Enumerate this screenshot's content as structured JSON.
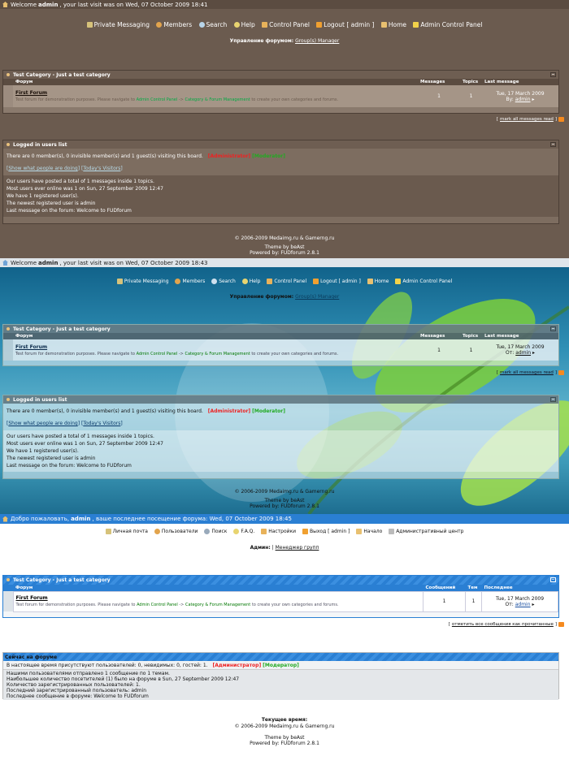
{
  "t1": {
    "welcome_pre": "Welcome",
    "user": "admin",
    "welcome_post": ", your last visit was on Wed, 07 October 2009 18:41",
    "nav": [
      "Private Messaging",
      "Members",
      "Search",
      "Help",
      "Control Panel",
      "Logout [ admin ]",
      "Home",
      "Admin Control Panel"
    ],
    "admin_label": "Управление форумом:",
    "admin_link": "Group(s) Manager",
    "category": "Test Category - Just a test category",
    "col_forum": "Форум",
    "col_messages": "Messages",
    "col_topics": "Topics",
    "col_last": "Last message",
    "forum_name": "First Forum",
    "forum_desc_pre": "Test forum for demonstration purposes. Please navigate to ",
    "forum_link1": "Admin Control Panel",
    "forum_arrow": " -> ",
    "forum_link2": "Category & Forum Management",
    "forum_desc_post": " to create your own categories and forums.",
    "messages": "1",
    "topics": "1",
    "last_date": "Tue, 17 March 2009",
    "by": "By:",
    "by_user": "admin",
    "mark_read": "mark all messages read",
    "logged_title": "Logged in users list",
    "online_line": "There are 0 member(s), 0 invisible member(s) and 1 guest(s) visiting this board.",
    "administrator": "[Administrator]",
    "moderator": "[Moderator]",
    "show_doing": "Show what people are doing",
    "todays": "Today's Visitors",
    "stats": [
      "Our users have posted a total of 1 messages inside 1 topics.",
      "Most users ever online was 1 on Sun, 27 September 2009 12:47",
      "We have 1 registered user(s).",
      "The newest registered user is admin",
      "Last message on the forum: Welcome to FUDforum"
    ],
    "copyright": "© 2006-2009 Medaimg.ru & Gamerng.ru",
    "theme_by": "Theme by beAst",
    "powered": "Powered by: FUDforum 2.8.1"
  },
  "t2": {
    "welcome_post": ", your last visit was on Wed, 07 October 2009 18:43",
    "nav": [
      "Private Messaging",
      "Members",
      "Search",
      "Help",
      "Control Panel",
      "Logout [ admin ]",
      "Home",
      "Admin Control Panel"
    ],
    "admin_label": "Управление форумом:",
    "admin_link": "Group(s) Manager",
    "by": "От:",
    "copyright": "© 2006-2009 Medaimg.ru & Gamerng.ru",
    "theme_by": "Theme by beAst",
    "powered": "Powered by: FUDforum 2.8.1"
  },
  "t3": {
    "welcome": "Добро пожаловать,",
    "user": "admin",
    "welcome_post": ", ваше последнее посещение форума: Wed, 07 October 2009 18:45",
    "nav": [
      "Личная почта",
      "Пользователи",
      "Поиск",
      "F.A.Q.",
      "Настройки",
      "Выход [ admin ]",
      "Начало",
      "Административный центр"
    ],
    "admin_label": "Админ:",
    "admin_link": "Менеджер групп",
    "category": "Test Category - Just a test category",
    "col_forum": "Форум",
    "col_messages": "Сообщений",
    "col_topics": "Тем",
    "col_last": "Последнее",
    "forum_name": "First Forum",
    "messages": "1",
    "topics": "1",
    "last_date": "Tue, 17 March 2009",
    "by": "От:",
    "by_user": "admin",
    "mark_read": "отметить все сообщения как прочитанные",
    "online_title": "Сейчас на форуме",
    "online_line": "В настоящее время присутствуют пользователей: 0, невидимых: 0, гостей: 1.",
    "administrator": "[Администратор]",
    "moderator": "[Модератор]",
    "stats": [
      "Нашими пользователями отправлено 1 сообщение по 1 темам.",
      "Наибольшее количество посетителей (1) было на форуме в Sun, 27 September 2009 12:47",
      "Количество зарегистрированных пользователей: 1.",
      "Последний зарегистрированный пользователь: admin",
      "Последнее сообщение в форуме: Welcome to FUDforum"
    ],
    "current_time": "Текущее время:",
    "copyright": "© 2006-2009 Medaimg.ru & Gamerng.ru",
    "theme_by": "Theme by beAst",
    "powered": "Powered by: FUDforum 2.8.1"
  },
  "colors": {
    "brown_bg": "#6b5b4f",
    "blue_bar": "#2a7fd3",
    "legend_red": "#e22",
    "legend_green": "#2a2"
  }
}
